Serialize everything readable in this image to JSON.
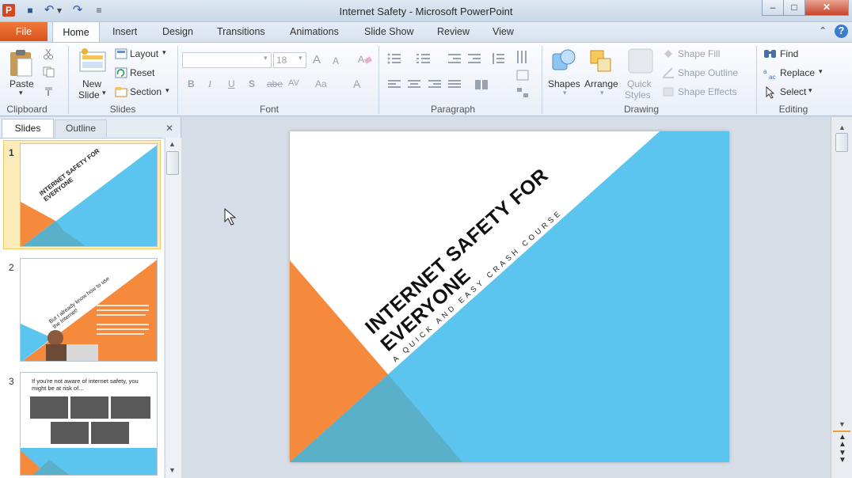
{
  "window": {
    "title": "Internet Safety  -  Microsoft PowerPoint",
    "min_symbol": "–",
    "max_symbol": "□",
    "close_symbol": "✕"
  },
  "qat": {
    "app_icon": "P",
    "save": "■",
    "undo": "↶",
    "undo_arrow": "▾",
    "redo": "↷",
    "customize": "≡"
  },
  "tabs": {
    "file": "File",
    "home": "Home",
    "insert": "Insert",
    "design": "Design",
    "transitions": "Transitions",
    "animations": "Animations",
    "slideshow": "Slide Show",
    "review": "Review",
    "view": "View",
    "collapse": "⌃",
    "help": "?"
  },
  "ribbon": {
    "clipboard": {
      "paste": "Paste",
      "label": "Clipboard"
    },
    "slides": {
      "new_slide_1": "New",
      "new_slide_2": "Slide",
      "layout": "Layout",
      "reset": "Reset",
      "section": "Section",
      "label": "Slides"
    },
    "font": {
      "size": "18",
      "grow": "A",
      "shrink": "A",
      "bold": "B",
      "italic": "I",
      "underline": "U",
      "shadow": "S",
      "strike": "abe",
      "spacing": "AV",
      "case": "Aa",
      "color": "A",
      "label": "Font"
    },
    "paragraph": {
      "label": "Paragraph"
    },
    "drawing": {
      "shapes": "Shapes",
      "arrange": "Arrange",
      "quick_1": "Quick",
      "quick_2": "Styles",
      "shape_fill": "Shape Fill",
      "shape_outline": "Shape Outline",
      "shape_effects": "Shape Effects",
      "label": "Drawing"
    },
    "editing": {
      "find": "Find",
      "replace": "Replace",
      "select": "Select",
      "label": "Editing"
    }
  },
  "left_pane": {
    "tab_slides": "Slides",
    "tab_outline": "Outline",
    "close": "✕",
    "thumbs": [
      {
        "num": "1",
        "title": "INTERNET SAFETY FOR EVERYONE"
      },
      {
        "num": "2",
        "title": "But I already know how to use the Internet!"
      },
      {
        "num": "3",
        "title": "If you're not aware of internet safety, you might be at risk of..."
      }
    ]
  },
  "slide": {
    "title": "INTERNET SAFETY FOR EVERYONE",
    "subtitle": "A QUICK AND EASY CRASH COURSE"
  },
  "colors": {
    "orange": "#f58a3c",
    "blue": "#5bc5f0",
    "teal": "#5aafc9",
    "accent": "#2b5797"
  }
}
